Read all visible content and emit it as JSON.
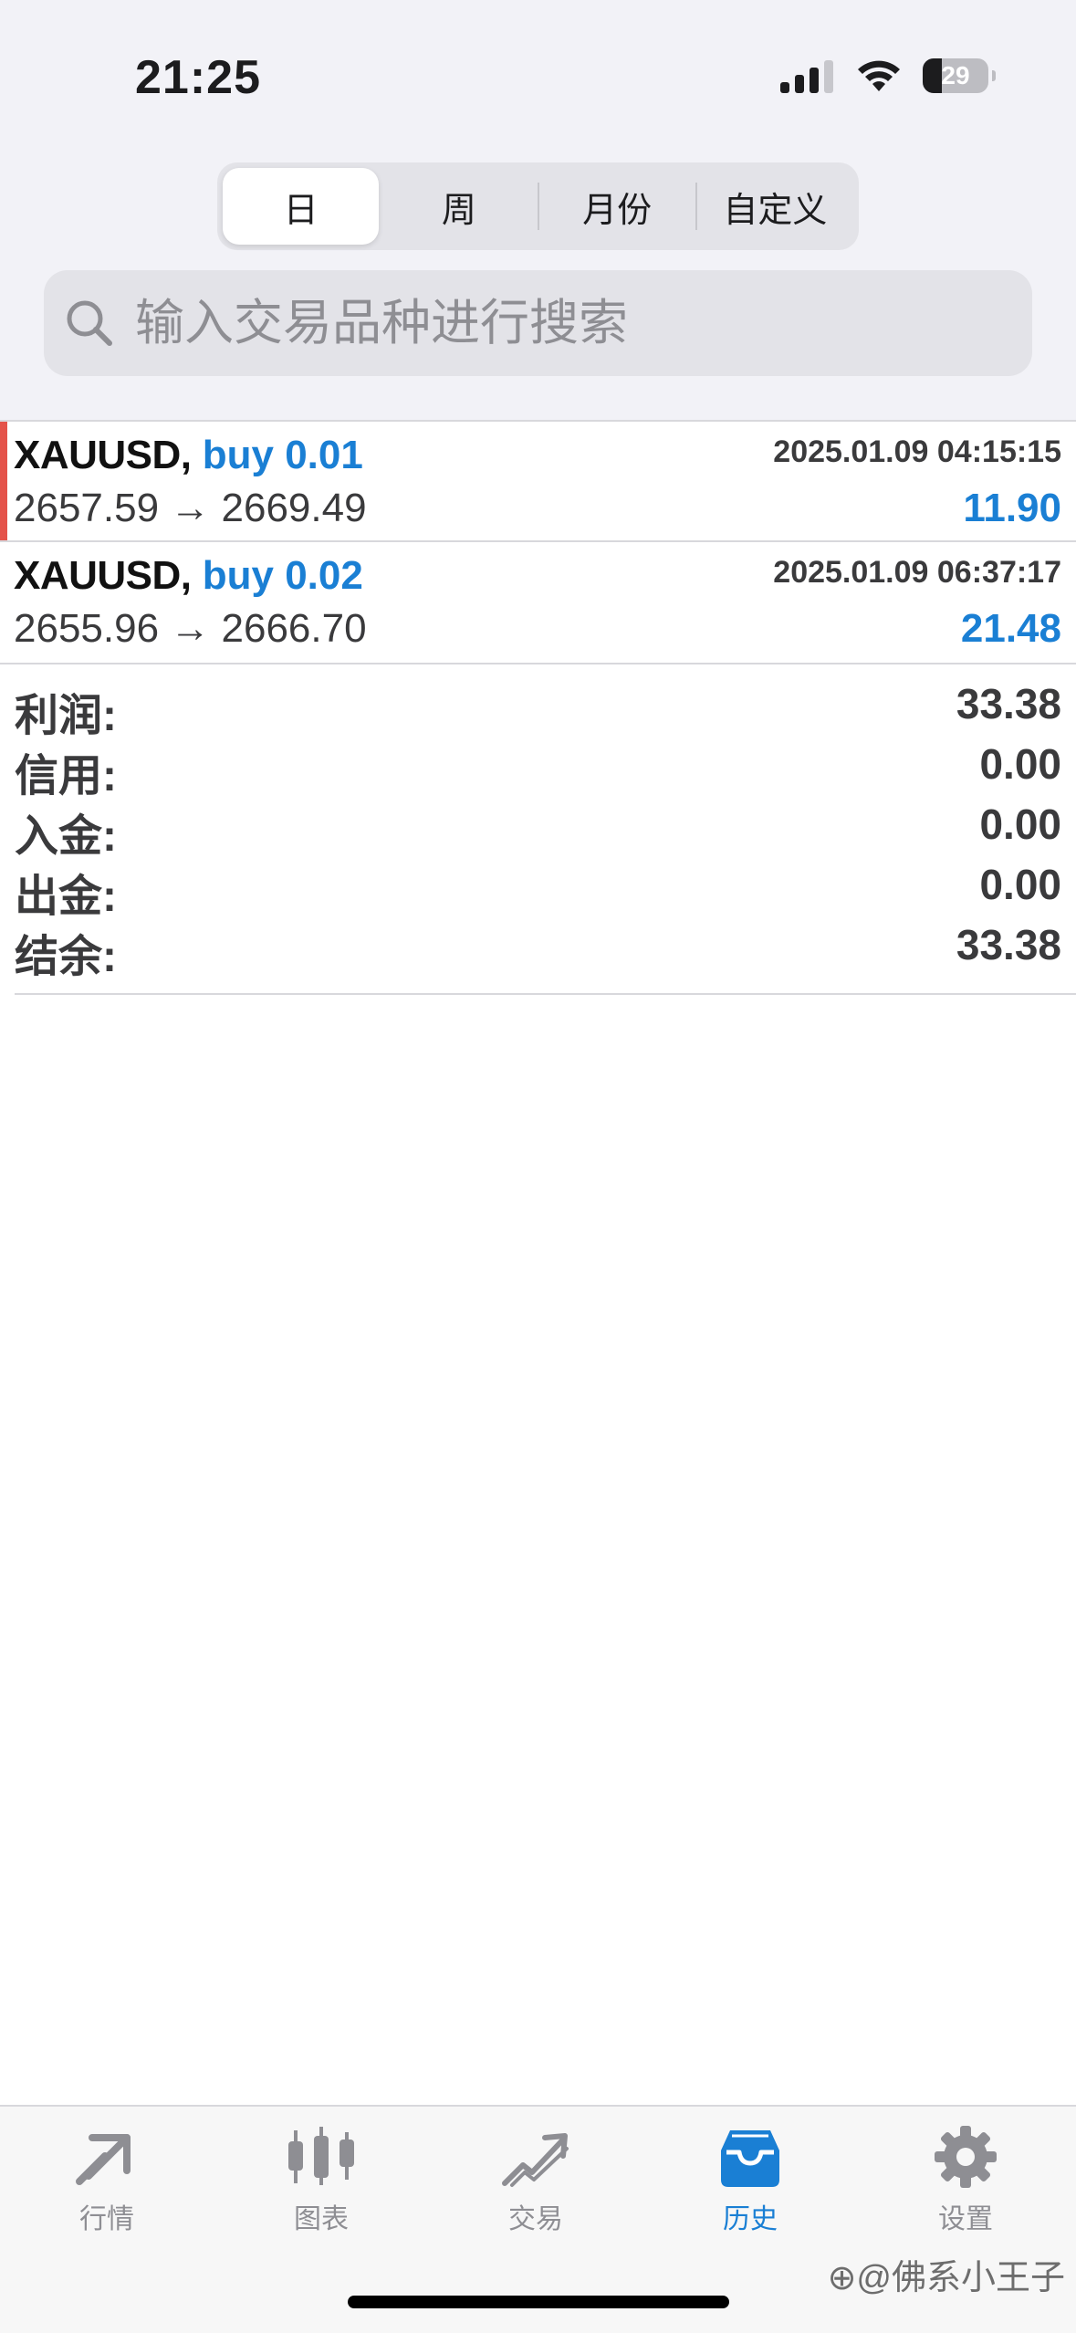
{
  "status_bar": {
    "time": "21:25",
    "battery": "29"
  },
  "period_tabs": [
    {
      "label": "日",
      "active": true
    },
    {
      "label": "周",
      "active": false
    },
    {
      "label": "月份",
      "active": false
    },
    {
      "label": "自定义",
      "active": false
    }
  ],
  "search": {
    "placeholder": "输入交易品种进行搜索",
    "value": ""
  },
  "trades": [
    {
      "symbol": "XAUUSD,",
      "side_volume": "buy 0.01",
      "time": "2025.01.09 04:15:15",
      "prices": "2657.59 → 2669.49",
      "profit": "11.90"
    },
    {
      "symbol": "XAUUSD,",
      "side_volume": "buy 0.02",
      "time": "2025.01.09 06:37:17",
      "prices": "2655.96 → 2666.70",
      "profit": "21.48"
    }
  ],
  "summary": [
    {
      "label": "利润:",
      "value": "33.38"
    },
    {
      "label": "信用:",
      "value": "0.00"
    },
    {
      "label": "入金:",
      "value": "0.00"
    },
    {
      "label": "出金:",
      "value": "0.00"
    },
    {
      "label": "结余:",
      "value": "33.38"
    }
  ],
  "tabbar": [
    {
      "label": "行情",
      "icon": "quotes-icon",
      "active": false
    },
    {
      "label": "图表",
      "icon": "chart-icon",
      "active": false
    },
    {
      "label": "交易",
      "icon": "trade-icon",
      "active": false
    },
    {
      "label": "历史",
      "icon": "history-icon",
      "active": true
    },
    {
      "label": "设置",
      "icon": "settings-icon",
      "active": false
    }
  ],
  "watermark": "⊕@佛系小王子",
  "colors": {
    "accent": "#1a7fd4",
    "marker": "#e4534a",
    "inactive": "#8e8e93"
  }
}
